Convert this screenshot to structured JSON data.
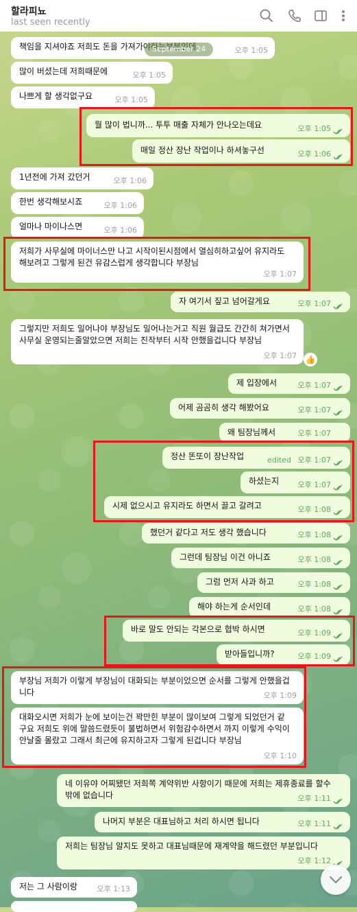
{
  "header": {
    "title": "할라피뇨",
    "status": "last seen recently"
  },
  "date_separator": "September 24",
  "messages": [
    {
      "text": "책임을 지셔야죠 저희도 돈을 가져가야하는부분인데",
      "time": "오후 1:05"
    },
    {
      "text": "많이 버셨는데 저희때문에",
      "time": "오후 1:05"
    },
    {
      "text": "나쁘게 할 생각없구요",
      "time": "오후 1:05"
    },
    {
      "text": "뭘 많이 법니까... 투투 매출 자체가 안나오는데요",
      "time": "오후 1:05"
    },
    {
      "text": "매일 정산 장난 작업이나 하셔놓구선",
      "time": "오후 1:06"
    },
    {
      "text": "1년전에 가져 갔던거",
      "time": "오후 1:06"
    },
    {
      "text": "한번 생각해보시죠",
      "time": "오후 1:06"
    },
    {
      "text": "얼마나 마이나스면",
      "time": "오후 1:06"
    },
    {
      "text": "저희가 사무실에 마이너스만 나고 시작이된시점에서 열심히하고싶어 유지라도 해보려고 그렇게 된건 유감스럽게 생각합니다 부장님",
      "time": "오후 1:07"
    },
    {
      "text": "자 여기서 짚고 넘어갈게요",
      "time": "오후 1:07"
    },
    {
      "text": "그렇지만 저희도 일어나야 부장님도 일어나는거고 직원 월급도 간간히 쳐가면서 사무실 운영되는줄알았으면 저희는 진작부터 시작 안했을겁니다 부장님",
      "time": "오후 1:07",
      "reaction": "👍"
    },
    {
      "text": "제 입장에서",
      "time": "오후 1:07"
    },
    {
      "text": "어제 곰곰히 생각 해봤어요",
      "time": "오후 1:07"
    },
    {
      "text": "왜 팀장님께서",
      "time": "오후 1:07"
    },
    {
      "text": "정산 똔또이 장난작업",
      "time": "오후 1:07",
      "edited": "edited"
    },
    {
      "text": "하셨는지",
      "time": "오후 1:07"
    },
    {
      "text": "시제 없으시고 유지라도 하면서 끌고 갈려고",
      "time": "오후 1:08"
    },
    {
      "text": "했던거 같다고 저도 생각 했습니다",
      "time": "오후 1:08"
    },
    {
      "text": "그런데 팀장님 이건 아니죠",
      "time": "오후 1:08"
    },
    {
      "text": "그럼 먼저 사과 하고",
      "time": "오후 1:08"
    },
    {
      "text": "해야 하는게 순서인데",
      "time": "오후 1:08"
    },
    {
      "text": "바로 말도 안되는 각본으로 협박 하시면",
      "time": "오후 1:09"
    },
    {
      "text": "받아들입니까?",
      "time": "오후 1:09"
    },
    {
      "text": "부장님 저희가 이렇게 부장님이 대화되는 부분이었으면 순서를 그렇게 안했을겁니다",
      "time": "오후 1:09"
    },
    {
      "text": "대화오시면 저희가 눈에 보이는건 꽉만힌 부분이 많이보여 그렇게 되었던거 같구요 저희도 위에 말씀드렸듯이 불법하면서 위험감수하면서 까지 이렇게 수익이 안날줄 몰랐고 그래서 최근에 유지하고자 그렇게 된겁니다 부장님",
      "time": "오후 1:10"
    },
    {
      "text": "네 이유야 어찌됐던 저희쪽 계약위반 사항이기 때문에 저희는 제휴종료를 할수 밖에 없습니다",
      "time": "오후 1:11"
    },
    {
      "text": "나머지 부분은 대표님하고 처리 하시면 됩니다",
      "time": "오후 1:11"
    },
    {
      "text": "저희는 팀장님 알지도 못하고 대표님때문에 재계약을 해드렸던 부분입니다",
      "time": "오후 1:12"
    },
    {
      "text": "저는 그 사람이랑",
      "time": "오후 1:13"
    }
  ],
  "colors": {
    "highlight": "#e8151b",
    "outgoing": "#effdde",
    "incoming": "#ffffff",
    "check": "#5fa85a"
  },
  "icons": [
    "search-icon",
    "phone-icon",
    "sidebar-toggle-icon",
    "more-icon",
    "double-check-icon",
    "chevron-down-icon"
  ]
}
